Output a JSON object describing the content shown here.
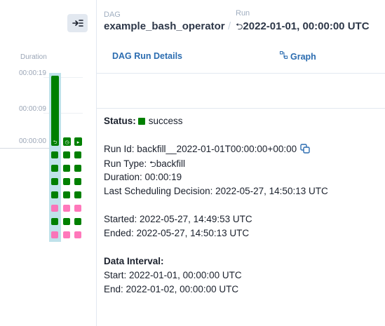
{
  "header": {
    "dag_label": "DAG",
    "dag_id": "example_bash_operator",
    "separator": "/",
    "run_label": "Run",
    "run_glyph": "⮌",
    "run_value": "2022-01-01, 00:00:00 UTC"
  },
  "grid": {
    "duration_title": "Duration",
    "ticks": [
      "00:00:19",
      "00:00:09",
      "00:00:00"
    ],
    "runs": [
      {
        "duration_fraction": 1.0,
        "type_glyph": "⮌"
      },
      {
        "duration_fraction": 0.05,
        "type_glyph": "◷"
      },
      {
        "duration_fraction": 0.1,
        "type_glyph": "▸"
      }
    ],
    "task_rows": [
      [
        "success",
        "success",
        "success"
      ],
      [
        "success",
        "success",
        "success"
      ],
      [
        "success",
        "success",
        "success"
      ],
      [
        "success",
        "success",
        "success"
      ],
      [
        "up_for_retry",
        "up_for_retry",
        "up_for_retry"
      ],
      [
        "success",
        "success",
        "success"
      ],
      [
        "up_for_retry",
        "up_for_retry",
        "up_for_retry"
      ]
    ]
  },
  "tabs": {
    "details": "DAG Run Details",
    "graph": "Graph"
  },
  "details": {
    "status_label": "Status:",
    "status_value": "success",
    "run_id_label": "Run Id:",
    "run_id_value": "backfill__2022-01-01T00:00:00+00:00",
    "run_type_label": "Run Type:",
    "run_type_glyph": "⮌",
    "run_type_value": "backfill",
    "duration_label": "Duration:",
    "duration_value": "00:00:19",
    "last_sched_label": "Last Scheduling Decision:",
    "last_sched_value": "2022-05-27, 14:50:13 UTC",
    "started_label": "Started:",
    "started_value": "2022-05-27, 14:49:53 UTC",
    "ended_label": "Ended:",
    "ended_value": "2022-05-27, 14:50:13 UTC",
    "interval_heading": "Data Interval:",
    "start_label": "Start:",
    "start_value": "2022-01-01, 00:00:00 UTC",
    "end_label": "End:",
    "end_value": "2022-01-02, 00:00:00 UTC"
  },
  "colors": {
    "success": "#008000",
    "up_for_retry": "#ff69b4",
    "selected_run": "#bfe2ea",
    "link": "#2b6cb0"
  },
  "icons": {
    "collapse": "collapse-panel-icon",
    "graph": "graph-icon",
    "copy": "copy-icon",
    "backfill": "backfill-icon"
  }
}
